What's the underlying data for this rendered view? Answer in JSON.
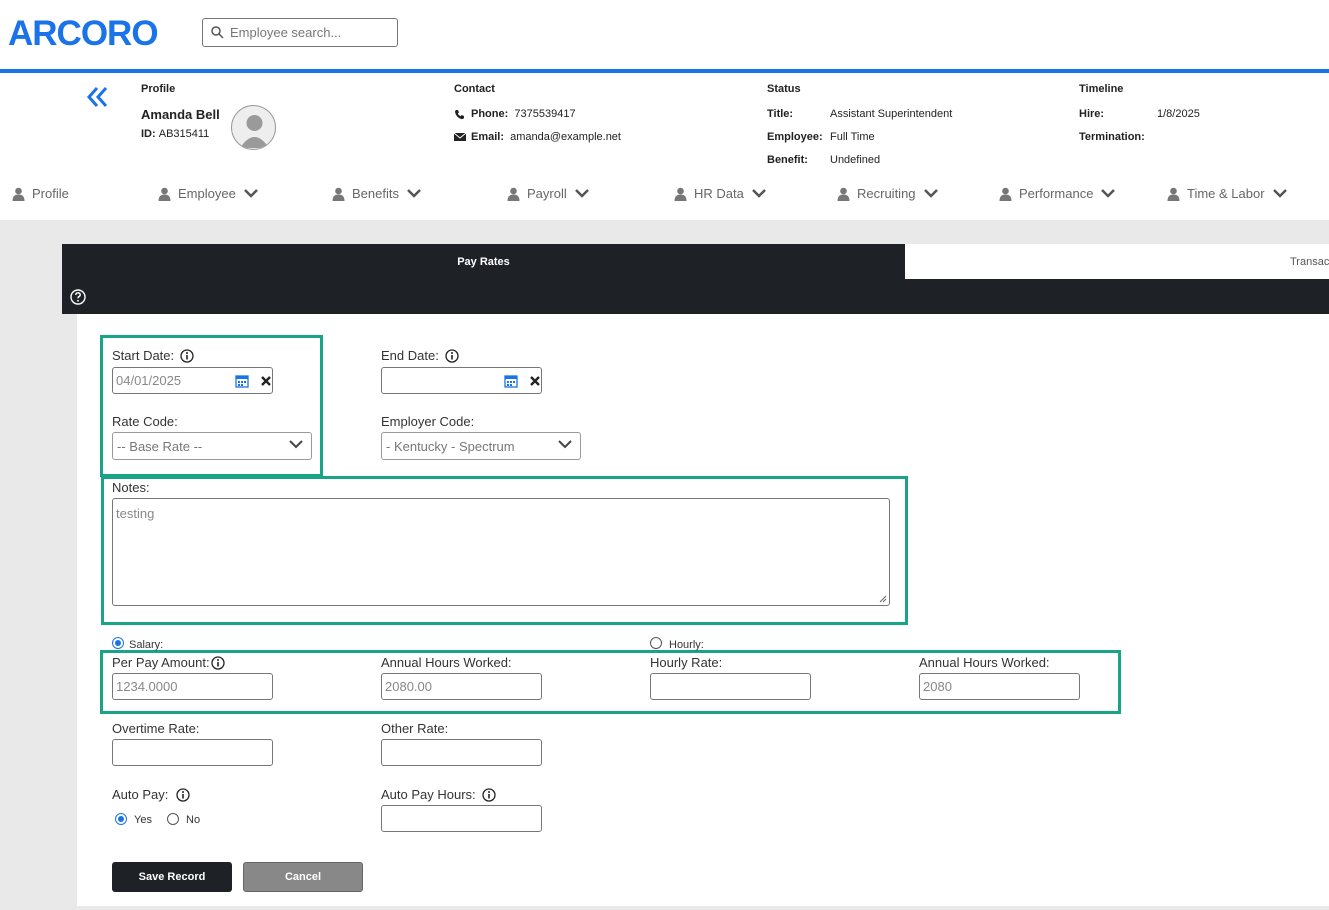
{
  "brand": {
    "logo": "ARCORO",
    "color": "#1a73e8"
  },
  "search": {
    "placeholder": "Employee search..."
  },
  "profile": {
    "title": "Profile",
    "name": "Amanda Bell",
    "id_label": "ID:",
    "id_value": "AB315411"
  },
  "contact": {
    "title": "Contact",
    "phone_label": "Phone:",
    "phone": "7375539417",
    "email_label": "Email:",
    "email": "amanda@example.net"
  },
  "status": {
    "title": "Status",
    "title_label": "Title:",
    "title_value": "Assistant Superintendent",
    "employee_label": "Employee:",
    "employee_value": "Full Time",
    "benefit_label": "Benefit:",
    "benefit_value": "Undefined"
  },
  "timeline": {
    "title": "Timeline",
    "hire_label": "Hire:",
    "hire_value": "1/8/2025",
    "termination_label": "Termination:",
    "termination_value": ""
  },
  "nav": [
    "Profile",
    "Employee",
    "Benefits",
    "Payroll",
    "HR Data",
    "Recruiting",
    "Performance",
    "Time & Labor"
  ],
  "tabs": {
    "active": "Pay Rates",
    "inactive": "Transactions"
  },
  "form": {
    "start_date_label": "Start Date:",
    "start_date": "04/01/2025",
    "end_date_label": "End Date:",
    "end_date": "",
    "rate_code_label": "Rate Code:",
    "rate_code": "-- Base Rate --",
    "employer_code_label": "Employer Code:",
    "employer_code": "- Kentucky - Spectrum",
    "notes_label": "Notes:",
    "notes": "testing",
    "salary_label": "Salary:",
    "hourly_label": "Hourly:",
    "pay_type_selected": "Salary",
    "per_pay_amount_label": "Per Pay Amount:",
    "per_pay_amount": "1234.0000",
    "annual_hours_label": "Annual Hours Worked:",
    "annual_hours_salary": "2080.00",
    "hourly_rate_label": "Hourly Rate:",
    "hourly_rate": "",
    "annual_hours_hourly": "2080",
    "overtime_rate_label": "Overtime Rate:",
    "other_rate_label": "Other Rate:",
    "auto_pay_label": "Auto Pay:",
    "auto_pay_yes": "Yes",
    "auto_pay_no": "No",
    "auto_pay_selected": "Yes",
    "auto_pay_hours_label": "Auto Pay Hours:"
  },
  "buttons": {
    "save": "Save Record",
    "cancel": "Cancel"
  },
  "colors": {
    "highlight": "#1aa487",
    "dark": "#1e2126",
    "accent": "#1a73e8"
  }
}
